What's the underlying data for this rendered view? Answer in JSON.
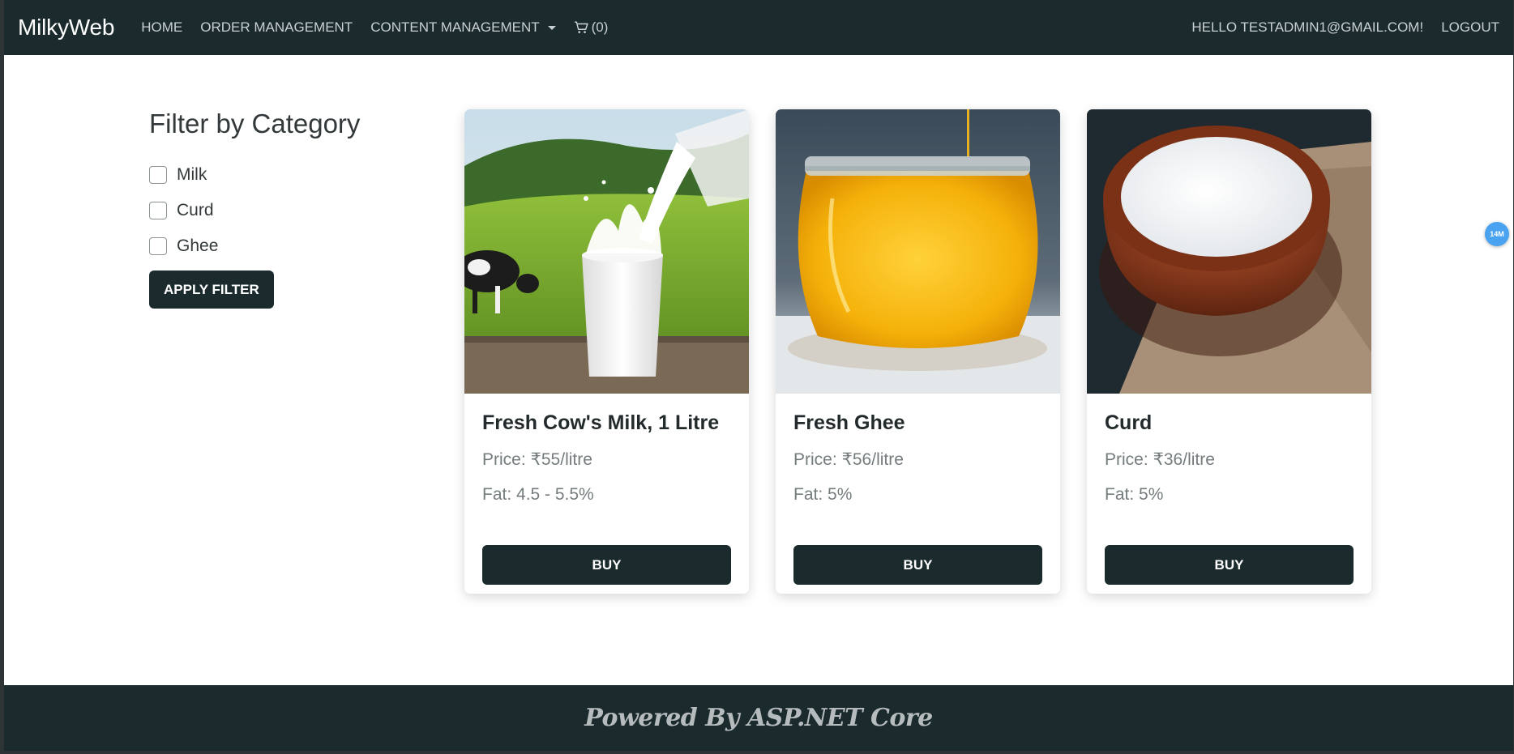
{
  "navbar": {
    "brand": "MilkyWeb",
    "links": [
      "HOME",
      "ORDER MANAGEMENT",
      "CONTENT MANAGEMENT"
    ],
    "cart_label": "(0)",
    "greeting": "HELLO TESTADMIN1@GMAIL.COM!",
    "logout": "LOGOUT"
  },
  "filter": {
    "title": "Filter by Category",
    "options": [
      "Milk",
      "Curd",
      "Ghee"
    ],
    "apply_label": "APPLY FILTER"
  },
  "products": [
    {
      "name": "Fresh Cow's Milk, 1 Litre",
      "price": "Price: ₹55/litre",
      "fat": "Fat: 4.5 - 5.5%",
      "buy": "BUY"
    },
    {
      "name": "Fresh Ghee",
      "price": "Price: ₹56/litre",
      "fat": "Fat: 5%",
      "buy": "BUY"
    },
    {
      "name": "Curd",
      "price": "Price: ₹36/litre",
      "fat": "Fat: 5%",
      "buy": "BUY"
    }
  ],
  "footer": {
    "text": "Powered By ASP.NET Core"
  },
  "badge": {
    "text": "14M"
  },
  "colors": {
    "primary": "#1b2b2d",
    "badge": "#4aa3f0"
  }
}
